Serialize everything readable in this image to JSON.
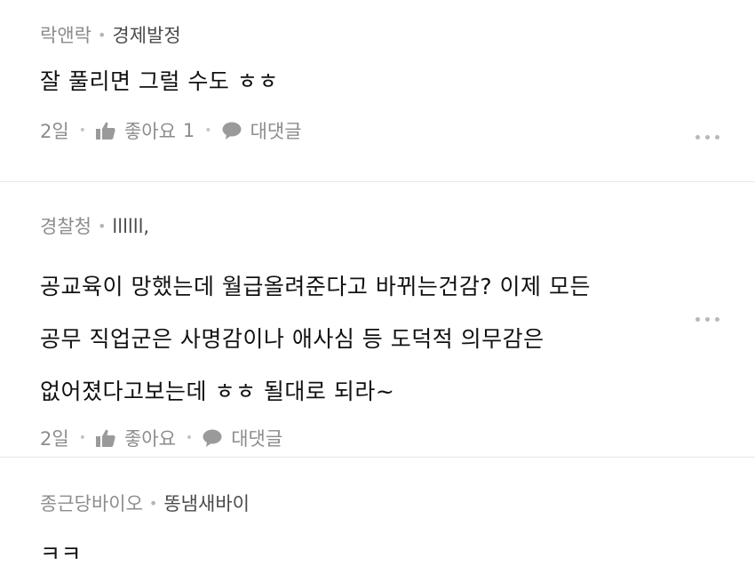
{
  "comments": [
    {
      "level": "락앤락",
      "nickname": "경제발정",
      "lines": [
        "잘 풀리면 그럴 수도 ㅎㅎ"
      ],
      "time": "2일",
      "like_label": "좋아요",
      "like_count": "1",
      "reply_label": "대댓글"
    },
    {
      "level": "경찰청",
      "nickname": "llllll,",
      "lines": [
        "공교육이 망했는데 월급올려준다고 바뀌는건감? 이제 모든",
        "공무 직업군은 사명감이나 애사심 등 도덕적 의무감은",
        "없어졌다고보는데 ㅎㅎ 될대로 되라~"
      ],
      "time": "2일",
      "like_label": "좋아요",
      "like_count": "",
      "reply_label": "대댓글"
    },
    {
      "level": "종근당바이오",
      "nickname": "똥냄새바이",
      "lines": [
        "ㅋㅋ"
      ]
    }
  ],
  "icons": {
    "like": "thumbs-up-icon",
    "reply": "speech-bubble-icon",
    "more": "more-dots-icon"
  },
  "colors": {
    "meta_gray": "#8c8c8c",
    "divider": "#e8e8e8",
    "text": "#111111"
  }
}
